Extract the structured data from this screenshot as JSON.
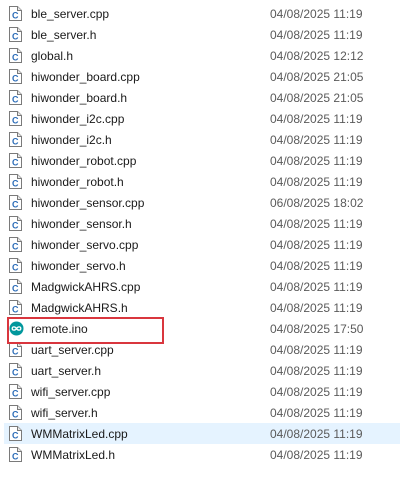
{
  "files": [
    {
      "name": "ble_server.cpp",
      "modified": "04/08/2025 11:19",
      "icon": "c-source-file-icon"
    },
    {
      "name": "ble_server.h",
      "modified": "04/08/2025 11:19",
      "icon": "c-source-file-icon"
    },
    {
      "name": "global.h",
      "modified": "04/08/2025 12:12",
      "icon": "c-source-file-icon"
    },
    {
      "name": "hiwonder_board.cpp",
      "modified": "04/08/2025 21:05",
      "icon": "c-source-file-icon"
    },
    {
      "name": "hiwonder_board.h",
      "modified": "04/08/2025 21:05",
      "icon": "c-source-file-icon"
    },
    {
      "name": "hiwonder_i2c.cpp",
      "modified": "04/08/2025 11:19",
      "icon": "c-source-file-icon"
    },
    {
      "name": "hiwonder_i2c.h",
      "modified": "04/08/2025 11:19",
      "icon": "c-source-file-icon"
    },
    {
      "name": "hiwonder_robot.cpp",
      "modified": "04/08/2025 11:19",
      "icon": "c-source-file-icon"
    },
    {
      "name": "hiwonder_robot.h",
      "modified": "04/08/2025 11:19",
      "icon": "c-source-file-icon"
    },
    {
      "name": "hiwonder_sensor.cpp",
      "modified": "06/08/2025 18:02",
      "icon": "c-source-file-icon"
    },
    {
      "name": "hiwonder_sensor.h",
      "modified": "04/08/2025 11:19",
      "icon": "c-source-file-icon"
    },
    {
      "name": "hiwonder_servo.cpp",
      "modified": "04/08/2025 11:19",
      "icon": "c-source-file-icon"
    },
    {
      "name": "hiwonder_servo.h",
      "modified": "04/08/2025 11:19",
      "icon": "c-source-file-icon"
    },
    {
      "name": "MadgwickAHRS.cpp",
      "modified": "04/08/2025 11:19",
      "icon": "c-source-file-icon"
    },
    {
      "name": "MadgwickAHRS.h",
      "modified": "04/08/2025 11:19",
      "icon": "c-source-file-icon"
    },
    {
      "name": "remote.ino",
      "modified": "04/08/2025 17:50",
      "icon": "arduino-icon"
    },
    {
      "name": "uart_server.cpp",
      "modified": "04/08/2025 11:19",
      "icon": "c-source-file-icon"
    },
    {
      "name": "uart_server.h",
      "modified": "04/08/2025 11:19",
      "icon": "c-source-file-icon"
    },
    {
      "name": "wifi_server.cpp",
      "modified": "04/08/2025 11:19",
      "icon": "c-source-file-icon"
    },
    {
      "name": "wifi_server.h",
      "modified": "04/08/2025 11:19",
      "icon": "c-source-file-icon"
    },
    {
      "name": "WMMatrixLed.cpp",
      "modified": "04/08/2025 11:19",
      "icon": "c-source-file-icon",
      "selected": true
    },
    {
      "name": "WMMatrixLed.h",
      "modified": "04/08/2025 11:19",
      "icon": "c-source-file-icon"
    }
  ],
  "highlighted_file": "remote.ino",
  "colors": {
    "highlight_border": "#d9363e",
    "selected_row": "#e5f3ff",
    "arduino_teal": "#00979c"
  }
}
